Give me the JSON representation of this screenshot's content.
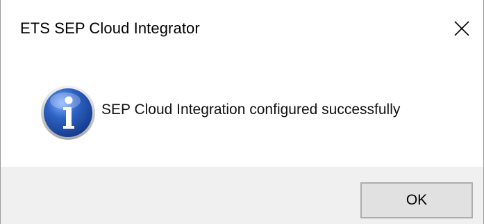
{
  "window": {
    "title": "ETS SEP Cloud Integrator",
    "close_icon": "close-icon"
  },
  "message": {
    "icon": "info-icon",
    "text": "SEP Cloud Integration configured successfully"
  },
  "buttons": {
    "ok_label": "OK"
  },
  "colors": {
    "content_background": "#ffffff",
    "footer_background": "#f0f0f0",
    "button_background": "#e1e1e1",
    "button_border": "#adadad",
    "icon_blue": "#1f4fa8"
  }
}
